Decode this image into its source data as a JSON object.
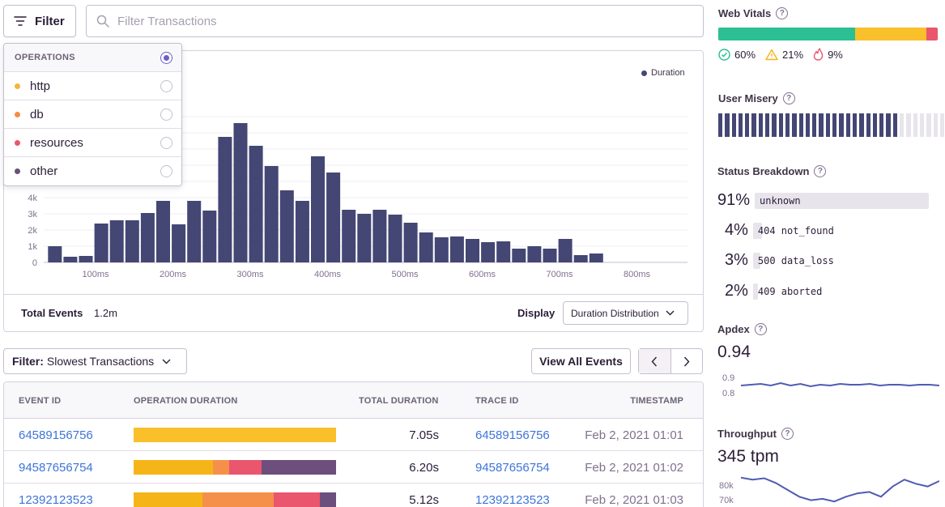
{
  "toolbar": {
    "filter_label": "Filter",
    "search_placeholder": "Filter Transactions"
  },
  "dropdown": {
    "header": "OPERATIONS",
    "items": [
      {
        "label": "http",
        "color": "#f5b43c"
      },
      {
        "label": "db",
        "color": "#f58c46"
      },
      {
        "label": "resources",
        "color": "#e9566e"
      },
      {
        "label": "other",
        "color": "#6c4f7c"
      }
    ]
  },
  "chart": {
    "legend": "Duration",
    "total_label": "Total Events",
    "total_value": "1.2m",
    "display_label": "Display",
    "display_value": "Duration Distribution"
  },
  "chart_data": {
    "type": "bar",
    "series": [
      {
        "name": "Duration",
        "color": "#444674"
      }
    ],
    "values": [
      1.0,
      0.35,
      0.4,
      2.4,
      2.6,
      2.6,
      3.05,
      3.8,
      2.35,
      3.8,
      3.2,
      7.75,
      8.6,
      7.2,
      5.95,
      4.45,
      3.8,
      6.55,
      5.55,
      3.25,
      3.0,
      3.25,
      2.95,
      2.45,
      1.85,
      1.55,
      1.6,
      1.45,
      1.25,
      1.3,
      0.85,
      1.0,
      0.85,
      1.45,
      0.45,
      0.55
    ],
    "x_start_ms": 50,
    "x_step_ms": 20,
    "xticks": [
      "100ms",
      "200ms",
      "300ms",
      "400ms",
      "500ms",
      "600ms",
      "700ms",
      "800ms"
    ],
    "xtick_values": [
      100,
      200,
      300,
      400,
      500,
      600,
      700,
      800
    ],
    "yticks": [
      "0",
      "1k",
      "2k",
      "3k",
      "4k"
    ],
    "ytick_values": [
      0,
      1,
      2,
      3,
      4
    ],
    "ylim": [
      0,
      9.5
    ],
    "grid": true
  },
  "table_controls": {
    "filter_prefix": "Filter:",
    "filter_value": "Slowest Transactions",
    "view_all": "View All Events"
  },
  "table": {
    "headers": [
      "EVENT ID",
      "OPERATION DURATION",
      "TOTAL DURATION",
      "TRACE ID",
      "TIMESTAMP"
    ],
    "rows": [
      {
        "event_id": "64589156756",
        "total": "7.05s",
        "trace_id": "64589156756",
        "timestamp": "Feb 2, 2021 01:01",
        "ops": [
          {
            "color": "#f9c02b",
            "pct": 100
          }
        ]
      },
      {
        "event_id": "94587656754",
        "total": "6.20s",
        "trace_id": "94587656754",
        "timestamp": "Feb 2, 2021 01:02",
        "ops": [
          {
            "color": "#f5b519",
            "pct": 39
          },
          {
            "color": "#f5904a",
            "pct": 8
          },
          {
            "color": "#e9566e",
            "pct": 16
          },
          {
            "color": "#6c4f7c",
            "pct": 37
          }
        ]
      },
      {
        "event_id": "12392123523",
        "total": "5.12s",
        "trace_id": "12392123523",
        "timestamp": "Feb 2, 2021 01:03",
        "ops": [
          {
            "color": "#f5b519",
            "pct": 34
          },
          {
            "color": "#f5904a",
            "pct": 35
          },
          {
            "color": "#e9566e",
            "pct": 23
          },
          {
            "color": "#6c4f7c",
            "pct": 8
          }
        ]
      }
    ]
  },
  "sidebar": {
    "web_vitals": {
      "title": "Web Vitals",
      "segments": [
        {
          "color": "#2cbf93",
          "pct": 62.5
        },
        {
          "color": "#f9c02b",
          "pct": 32.5
        },
        {
          "color": "#e9566e",
          "pct": 5
        }
      ],
      "good": "60%",
      "meh": "21%",
      "poor": "9%"
    },
    "user_misery": {
      "title": "User Misery",
      "filled": 27,
      "total": 40
    },
    "status": {
      "title": "Status Breakdown",
      "rows": [
        {
          "pct": "91%",
          "label": "unknown",
          "fill": 1.0
        },
        {
          "pct": "4%",
          "label": "404 not_found",
          "fill": 0.05
        },
        {
          "pct": "3%",
          "label": "500 data_loss",
          "fill": 0.04
        },
        {
          "pct": "2%",
          "label": "409 aborted",
          "fill": 0.03
        }
      ]
    },
    "apdex": {
      "title": "Apdex",
      "value": "0.94",
      "axis": [
        "0.9",
        "0.8"
      ],
      "points": [
        0.82,
        0.83,
        0.84,
        0.82,
        0.85,
        0.82,
        0.84,
        0.81,
        0.83,
        0.82,
        0.84,
        0.83,
        0.83,
        0.84,
        0.82,
        0.83,
        0.83,
        0.82,
        0.83,
        0.83,
        0.82
      ]
    },
    "throughput": {
      "title": "Throughput",
      "value": "345 tpm",
      "axis": [
        "80k",
        "70k"
      ],
      "points": [
        83,
        80,
        82,
        75,
        65,
        55,
        50,
        52,
        48,
        55,
        60,
        62,
        55,
        70,
        80,
        74,
        70,
        78
      ]
    }
  }
}
